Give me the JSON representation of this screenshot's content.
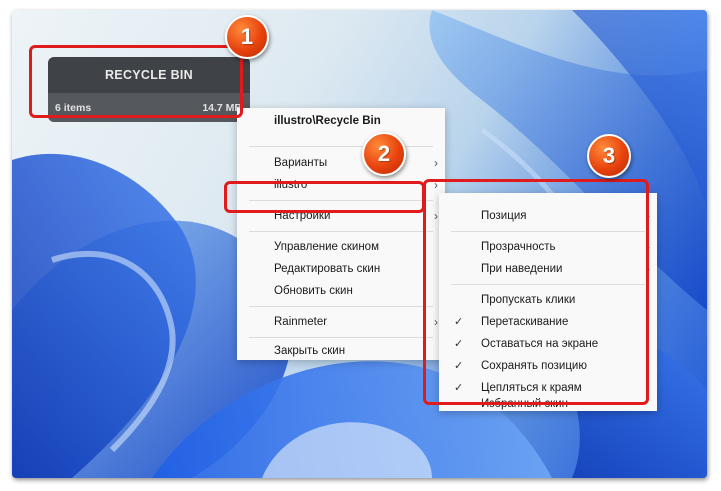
{
  "widget": {
    "title": "RECYCLE BIN",
    "items": "6 items",
    "size": "14.7 MB"
  },
  "context_menu": {
    "header": "illustro\\Recycle Bin",
    "items": [
      {
        "label": "Варианты",
        "has_submenu": true
      },
      {
        "label": "illustro",
        "has_submenu": true
      },
      {
        "label": "Настройки",
        "has_submenu": true
      },
      {
        "label": "Управление скином",
        "has_submenu": false
      },
      {
        "label": "Редактировать скин",
        "has_submenu": false
      },
      {
        "label": "Обновить скин",
        "has_submenu": false
      },
      {
        "label": "Rainmeter",
        "has_submenu": true
      },
      {
        "label": "Закрыть скин",
        "has_submenu": false
      }
    ]
  },
  "settings_submenu": {
    "items": [
      {
        "label": "Позиция",
        "has_submenu": true,
        "checked": false
      },
      {
        "label": "Прозрачность",
        "has_submenu": true,
        "checked": false
      },
      {
        "label": "При наведении",
        "has_submenu": true,
        "checked": false
      },
      {
        "label": "Пропускать клики",
        "has_submenu": false,
        "checked": false
      },
      {
        "label": "Перетаскивание",
        "has_submenu": false,
        "checked": true
      },
      {
        "label": "Оставаться на экране",
        "has_submenu": false,
        "checked": true
      },
      {
        "label": "Сохранять позицию",
        "has_submenu": false,
        "checked": true
      },
      {
        "label": "Цепляться к краям",
        "has_submenu": false,
        "checked": true
      },
      {
        "label": "Избранный скин",
        "has_submenu": false,
        "checked": false
      }
    ]
  },
  "badges": [
    "1",
    "2",
    "3"
  ],
  "colors": {
    "highlight": "#e01b1b",
    "badge": "#e8430e",
    "widget_title_bg": "#3f4246",
    "menu_bg": "#f9f9f9"
  },
  "icons": {
    "submenu_arrow": "chevron-right-icon",
    "checkmark": "checkmark-icon"
  }
}
